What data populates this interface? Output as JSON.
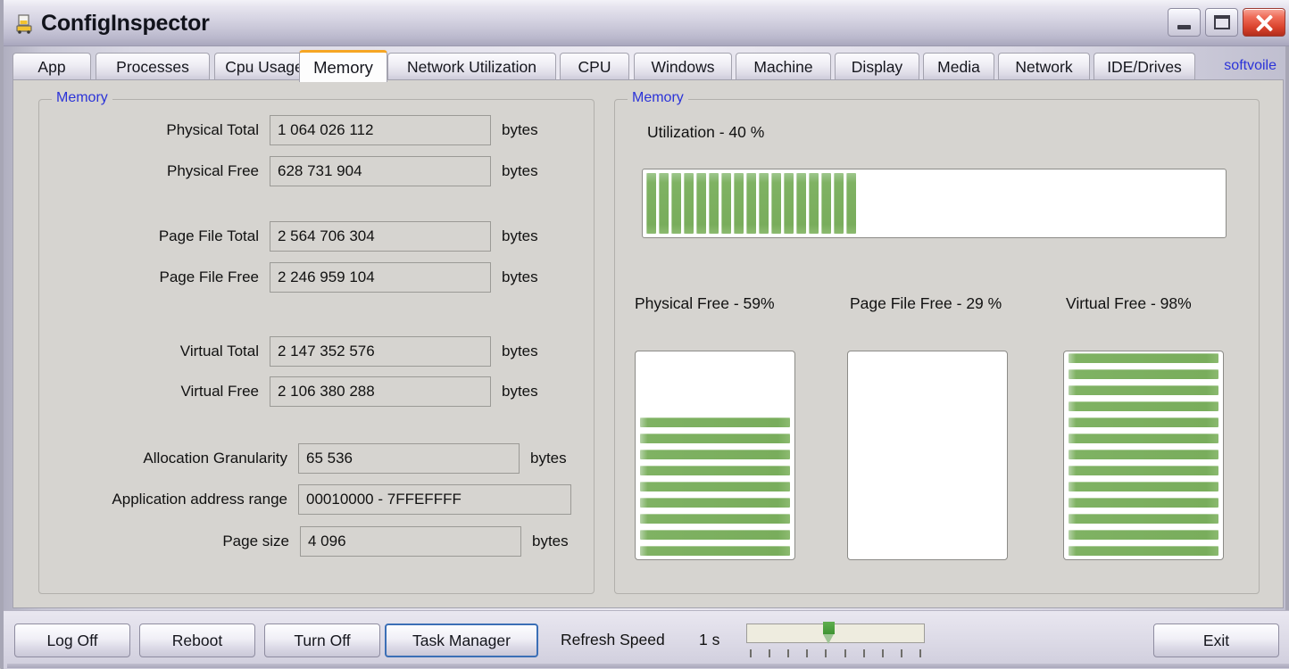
{
  "window": {
    "title": "ConfigInspector",
    "icon": "application-icon",
    "buttons": {
      "minimize": "minimize-icon",
      "maximize": "maximize-icon",
      "close": "close-icon"
    }
  },
  "tabs": [
    {
      "label": "App",
      "active": false
    },
    {
      "label": "Processes",
      "active": false
    },
    {
      "label": "Cpu Usage",
      "active": false
    },
    {
      "label": "Memory",
      "active": true
    },
    {
      "label": "Network Utilization",
      "active": false
    },
    {
      "label": "CPU",
      "active": false
    },
    {
      "label": "Windows",
      "active": false
    },
    {
      "label": "Machine",
      "active": false
    },
    {
      "label": "Display",
      "active": false
    },
    {
      "label": "Media",
      "active": false
    },
    {
      "label": "Network",
      "active": false
    },
    {
      "label": "IDE/Drives",
      "active": false
    }
  ],
  "brand_link": "softvoile",
  "left_panel": {
    "legend": "Memory",
    "fields": [
      {
        "label": "Physical Total",
        "value": "1 064 026 112",
        "unit": "bytes"
      },
      {
        "label": "Physical Free",
        "value": "628 731 904",
        "unit": "bytes"
      },
      {
        "label": "Page File Total",
        "value": "2 564 706 304",
        "unit": "bytes"
      },
      {
        "label": "Page File Free",
        "value": "2 246 959 104",
        "unit": "bytes"
      },
      {
        "label": "Virtual Total",
        "value": "2 147 352 576",
        "unit": "bytes"
      },
      {
        "label": "Virtual Free",
        "value": "2 106 380 288",
        "unit": "bytes"
      },
      {
        "label": "Allocation Granularity",
        "value": "65 536",
        "unit": "bytes"
      },
      {
        "label": "Application address range",
        "value": "00010000 - 7FFEFFFF",
        "unit": ""
      },
      {
        "label": "Page size",
        "value": "4 096",
        "unit": "bytes"
      }
    ]
  },
  "right_panel": {
    "legend": "Memory",
    "utilization": {
      "label": "Utilization -   40 %",
      "percent": 40,
      "segments_filled": 17,
      "segments_total": 43
    },
    "gauges": [
      {
        "title": "Physical Free -  59%",
        "percent": 59,
        "segments_filled": 9,
        "segments_total": 15
      },
      {
        "title": "Page File Free -  29 %",
        "percent": 29,
        "segments_filled": 0,
        "segments_total": 15
      },
      {
        "title": "Virtual Free -   98%",
        "percent": 98,
        "segments_filled": 15,
        "segments_total": 15
      }
    ]
  },
  "bottom_bar": {
    "buttons": [
      {
        "label": "Log Off",
        "focused": false
      },
      {
        "label": "Reboot",
        "focused": false
      },
      {
        "label": "Turn Off",
        "focused": false
      },
      {
        "label": "Task Manager",
        "focused": true
      }
    ],
    "refresh": {
      "label": "Refresh Speed",
      "value": "1 s",
      "slider_position_percent": 45,
      "tick_count": 10
    },
    "exit_label": "Exit"
  },
  "colors": {
    "accent_green": "#79ad5c",
    "legend_blue": "#2b33d8",
    "active_tab_top": "#f6a623",
    "close_red": "#d9422c",
    "focus_blue": "#3b6fb6"
  }
}
